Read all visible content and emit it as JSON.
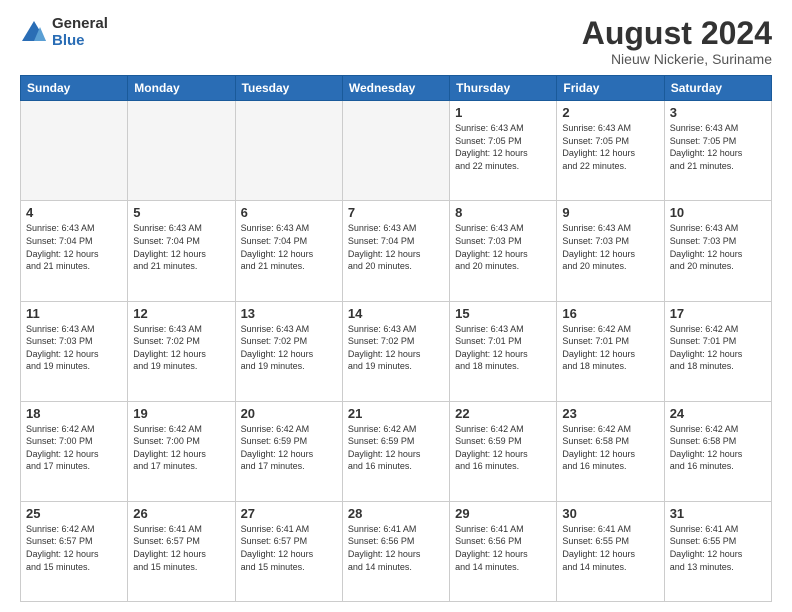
{
  "logo": {
    "general": "General",
    "blue": "Blue"
  },
  "title": {
    "month_year": "August 2024",
    "location": "Nieuw Nickerie, Suriname"
  },
  "days_of_week": [
    "Sunday",
    "Monday",
    "Tuesday",
    "Wednesday",
    "Thursday",
    "Friday",
    "Saturday"
  ],
  "weeks": [
    [
      {
        "day": "",
        "info": ""
      },
      {
        "day": "",
        "info": ""
      },
      {
        "day": "",
        "info": ""
      },
      {
        "day": "",
        "info": ""
      },
      {
        "day": "1",
        "info": "Sunrise: 6:43 AM\nSunset: 7:05 PM\nDaylight: 12 hours\nand 22 minutes."
      },
      {
        "day": "2",
        "info": "Sunrise: 6:43 AM\nSunset: 7:05 PM\nDaylight: 12 hours\nand 22 minutes."
      },
      {
        "day": "3",
        "info": "Sunrise: 6:43 AM\nSunset: 7:05 PM\nDaylight: 12 hours\nand 21 minutes."
      }
    ],
    [
      {
        "day": "4",
        "info": "Sunrise: 6:43 AM\nSunset: 7:04 PM\nDaylight: 12 hours\nand 21 minutes."
      },
      {
        "day": "5",
        "info": "Sunrise: 6:43 AM\nSunset: 7:04 PM\nDaylight: 12 hours\nand 21 minutes."
      },
      {
        "day": "6",
        "info": "Sunrise: 6:43 AM\nSunset: 7:04 PM\nDaylight: 12 hours\nand 21 minutes."
      },
      {
        "day": "7",
        "info": "Sunrise: 6:43 AM\nSunset: 7:04 PM\nDaylight: 12 hours\nand 20 minutes."
      },
      {
        "day": "8",
        "info": "Sunrise: 6:43 AM\nSunset: 7:03 PM\nDaylight: 12 hours\nand 20 minutes."
      },
      {
        "day": "9",
        "info": "Sunrise: 6:43 AM\nSunset: 7:03 PM\nDaylight: 12 hours\nand 20 minutes."
      },
      {
        "day": "10",
        "info": "Sunrise: 6:43 AM\nSunset: 7:03 PM\nDaylight: 12 hours\nand 20 minutes."
      }
    ],
    [
      {
        "day": "11",
        "info": "Sunrise: 6:43 AM\nSunset: 7:03 PM\nDaylight: 12 hours\nand 19 minutes."
      },
      {
        "day": "12",
        "info": "Sunrise: 6:43 AM\nSunset: 7:02 PM\nDaylight: 12 hours\nand 19 minutes."
      },
      {
        "day": "13",
        "info": "Sunrise: 6:43 AM\nSunset: 7:02 PM\nDaylight: 12 hours\nand 19 minutes."
      },
      {
        "day": "14",
        "info": "Sunrise: 6:43 AM\nSunset: 7:02 PM\nDaylight: 12 hours\nand 19 minutes."
      },
      {
        "day": "15",
        "info": "Sunrise: 6:43 AM\nSunset: 7:01 PM\nDaylight: 12 hours\nand 18 minutes."
      },
      {
        "day": "16",
        "info": "Sunrise: 6:42 AM\nSunset: 7:01 PM\nDaylight: 12 hours\nand 18 minutes."
      },
      {
        "day": "17",
        "info": "Sunrise: 6:42 AM\nSunset: 7:01 PM\nDaylight: 12 hours\nand 18 minutes."
      }
    ],
    [
      {
        "day": "18",
        "info": "Sunrise: 6:42 AM\nSunset: 7:00 PM\nDaylight: 12 hours\nand 17 minutes."
      },
      {
        "day": "19",
        "info": "Sunrise: 6:42 AM\nSunset: 7:00 PM\nDaylight: 12 hours\nand 17 minutes."
      },
      {
        "day": "20",
        "info": "Sunrise: 6:42 AM\nSunset: 6:59 PM\nDaylight: 12 hours\nand 17 minutes."
      },
      {
        "day": "21",
        "info": "Sunrise: 6:42 AM\nSunset: 6:59 PM\nDaylight: 12 hours\nand 16 minutes."
      },
      {
        "day": "22",
        "info": "Sunrise: 6:42 AM\nSunset: 6:59 PM\nDaylight: 12 hours\nand 16 minutes."
      },
      {
        "day": "23",
        "info": "Sunrise: 6:42 AM\nSunset: 6:58 PM\nDaylight: 12 hours\nand 16 minutes."
      },
      {
        "day": "24",
        "info": "Sunrise: 6:42 AM\nSunset: 6:58 PM\nDaylight: 12 hours\nand 16 minutes."
      }
    ],
    [
      {
        "day": "25",
        "info": "Sunrise: 6:42 AM\nSunset: 6:57 PM\nDaylight: 12 hours\nand 15 minutes."
      },
      {
        "day": "26",
        "info": "Sunrise: 6:41 AM\nSunset: 6:57 PM\nDaylight: 12 hours\nand 15 minutes."
      },
      {
        "day": "27",
        "info": "Sunrise: 6:41 AM\nSunset: 6:57 PM\nDaylight: 12 hours\nand 15 minutes."
      },
      {
        "day": "28",
        "info": "Sunrise: 6:41 AM\nSunset: 6:56 PM\nDaylight: 12 hours\nand 14 minutes."
      },
      {
        "day": "29",
        "info": "Sunrise: 6:41 AM\nSunset: 6:56 PM\nDaylight: 12 hours\nand 14 minutes."
      },
      {
        "day": "30",
        "info": "Sunrise: 6:41 AM\nSunset: 6:55 PM\nDaylight: 12 hours\nand 14 minutes."
      },
      {
        "day": "31",
        "info": "Sunrise: 6:41 AM\nSunset: 6:55 PM\nDaylight: 12 hours\nand 13 minutes."
      }
    ]
  ]
}
